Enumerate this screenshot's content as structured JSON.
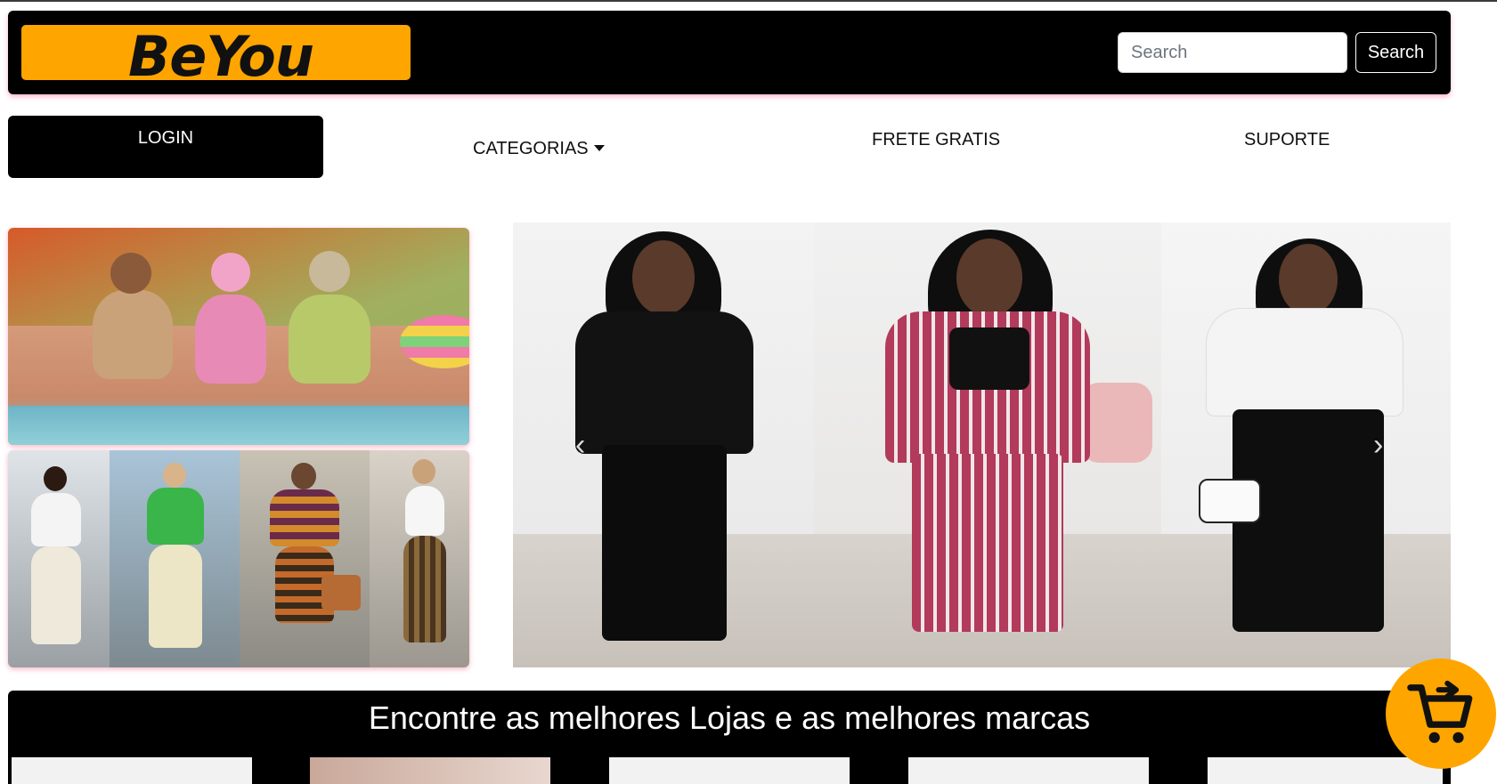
{
  "header": {
    "logo_text": "BeYou",
    "search": {
      "placeholder": "Search",
      "value": "",
      "button_label": "Search"
    }
  },
  "nav": {
    "login_label": "LOGIN",
    "categories_label": "CATEGORIAS",
    "free_shipping_label": "FRETE GRATIS",
    "support_label": "SUPORTE"
  },
  "banner": {
    "title": "Encontre as melhores Lojas e as melhores marcas"
  },
  "icons": {
    "cart": "add-to-cart-icon",
    "categories_caret": "caret-down-icon",
    "carousel_prev": "chevron-left-icon",
    "carousel_next": "chevron-right-icon"
  },
  "colors": {
    "brand_accent": "#ffa500",
    "header_bg": "#000000",
    "header_shadow": "#ff6490"
  }
}
